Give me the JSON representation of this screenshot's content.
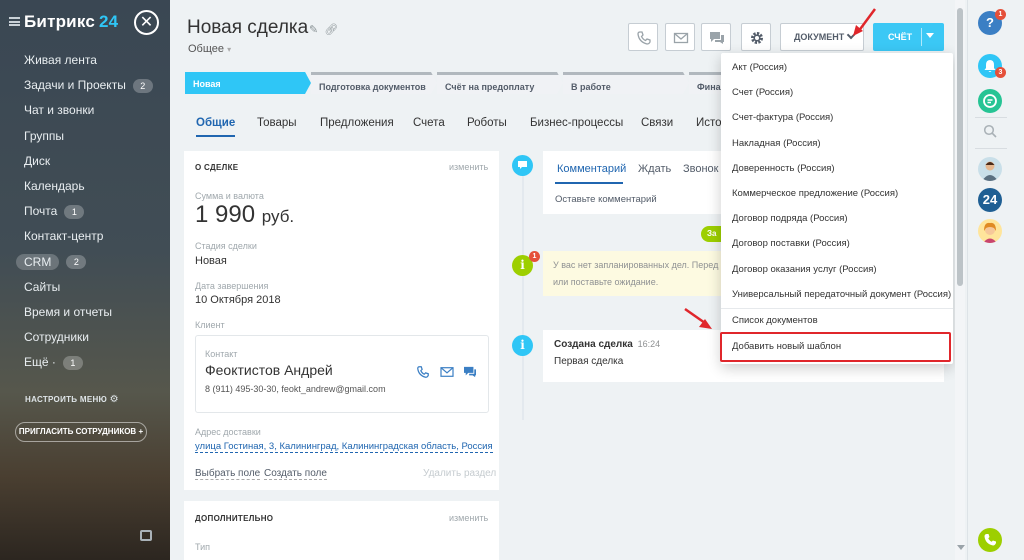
{
  "sidebar": {
    "logo": "Битрикс",
    "logo_num": "24",
    "close_icon": "close-icon",
    "items": [
      {
        "label": "Живая лента",
        "count": ""
      },
      {
        "label": "Задачи и Проекты",
        "count": "2"
      },
      {
        "label": "Чат и звонки",
        "count": ""
      },
      {
        "label": "Группы",
        "count": ""
      },
      {
        "label": "Диск",
        "count": ""
      },
      {
        "label": "Календарь",
        "count": ""
      },
      {
        "label": "Почта",
        "count": "1"
      },
      {
        "label": "Контакт-центр",
        "count": ""
      },
      {
        "label": "CRM",
        "count": "2"
      },
      {
        "label": "Сайты",
        "count": ""
      },
      {
        "label": "Время и отчеты",
        "count": ""
      },
      {
        "label": "Сотрудники",
        "count": ""
      },
      {
        "label": "Ещё ·",
        "count": "1"
      }
    ],
    "settings": "НАСТРОИТЬ МЕНЮ",
    "invite": "ПРИГЛАСИТЬ СОТРУДНИКОВ"
  },
  "header": {
    "title": "Новая сделка",
    "subtitle": "Общее",
    "doc_button": "ДОКУМЕНТ",
    "invoice_button": "СЧЁТ"
  },
  "stages": [
    "Новая",
    "Подготовка документов",
    "Счёт на предоплату",
    "В работе",
    "Фина"
  ],
  "tabs": [
    "Общие",
    "Товары",
    "Предложения",
    "Счета",
    "Роботы",
    "Бизнес-процессы",
    "Связи",
    "Исто"
  ],
  "deal": {
    "section_title": "О СДЕЛКЕ",
    "edit": "изменить",
    "amount_label": "Сумма и валюта",
    "amount": "1 990",
    "currency": "руб.",
    "stage_label": "Стадия сделки",
    "stage_value": "Новая",
    "close_label": "Дата завершения",
    "close_value": "10 Октября 2018",
    "client_label": "Клиент",
    "contact_label": "Контакт",
    "contact_name": "Феоктистов Андрей",
    "contact_info": "8 (911) 495-30-30, feokt_andrew@gmail.com",
    "address_label": "Адрес доставки",
    "address": "улица Гостиная, 3, Калининград, Калининградская область, Россия",
    "choose_field": "Выбрать поле",
    "create_field": "Создать поле",
    "delete_section": "Удалить раздел",
    "extra_title": "ДОПОЛНИТЕЛЬНО",
    "extra_edit": "изменить",
    "type_label": "Тип"
  },
  "timeline": {
    "tabs": [
      "Комментарий",
      "Ждать",
      "Звонок"
    ],
    "comment_placeholder": "Оставьте комментарий",
    "badge_text": "За",
    "info_line1": "У вас нет запланированных дел. Перед",
    "info_line2": "или поставьте ожидание.",
    "created_title": "Создана сделка",
    "created_time": "16:24",
    "created_text": "Первая сделка"
  },
  "dropdown": {
    "items": [
      "Акт (Россия)",
      "Счет (Россия)",
      "Счет-фактура (Россия)",
      "Накладная (Россия)",
      "Доверенность (Россия)",
      "Коммерческое предложение (Россия)",
      "Договор подряда (Россия)",
      "Договор поставки (Россия)",
      "Договор оказания услуг (Россия)",
      "Универсальный передаточный документ (Россия)",
      "Список документов"
    ],
    "add_template": "Добавить новый шаблон"
  },
  "right_panel": {
    "help_badge": "1",
    "notify_badge": "3",
    "b24": "24"
  },
  "colors": {
    "accent": "#2fc6f6",
    "highlight": "#e0262b",
    "link": "#2066b0"
  }
}
